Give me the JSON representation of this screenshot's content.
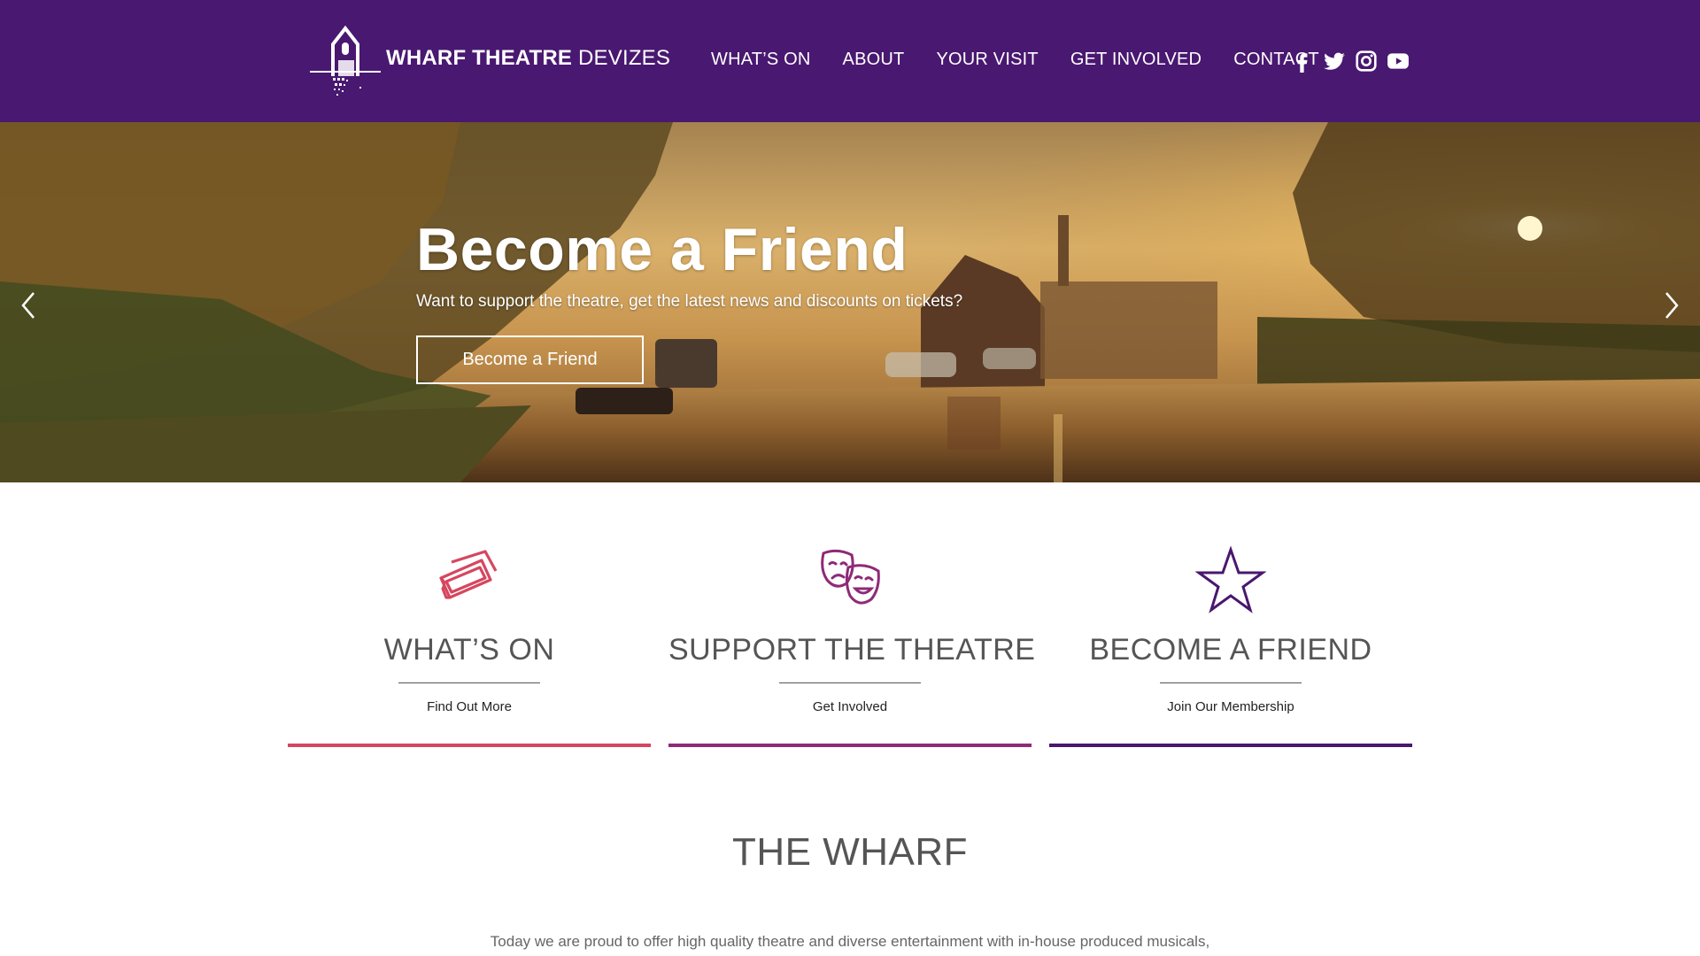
{
  "colors": {
    "header_bg": "#491870",
    "accent_red": "#d6465f",
    "accent_magenta": "#8e2a77",
    "accent_purple": "#4a176e"
  },
  "brand": {
    "name_bold": "WHARF THEATRE",
    "name_light": " DEVIZES"
  },
  "nav": {
    "items": [
      {
        "label": "WHAT’S ON"
      },
      {
        "label": "ABOUT"
      },
      {
        "label": "YOUR VISIT"
      },
      {
        "label": "GET INVOLVED"
      },
      {
        "label": "CONTACT"
      }
    ]
  },
  "social": [
    "facebook-icon",
    "twitter-icon",
    "instagram-icon",
    "youtube-icon"
  ],
  "hero": {
    "title": "Become a Friend",
    "subtitle": "Want to support the theatre, get the latest news and discounts on tickets?",
    "button_label": "Become a Friend"
  },
  "cards": [
    {
      "icon": "tickets-icon",
      "title": "WHAT’S ON",
      "link": "Find Out More",
      "color": "#d6465f"
    },
    {
      "icon": "theatre-masks-icon",
      "title": "SUPPORT THE THEATRE",
      "link": "Get Involved",
      "color": "#8e2a77"
    },
    {
      "icon": "star-icon",
      "title": "BECOME A FRIEND",
      "link": "Join Our Membership",
      "color": "#4a176e"
    }
  ],
  "section": {
    "title": "THE WHARF",
    "intro": "Today we are proud to offer high quality theatre and diverse entertainment with in-house produced musicals,"
  }
}
